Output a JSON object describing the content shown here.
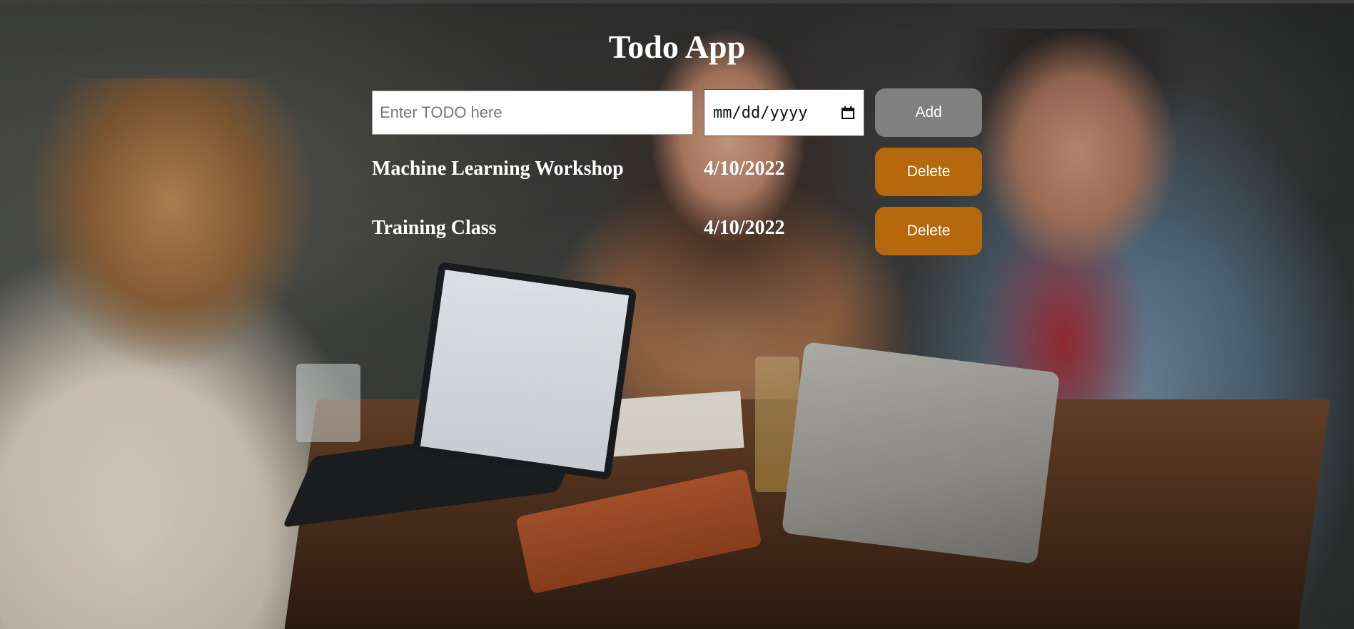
{
  "app": {
    "title": "Todo App"
  },
  "form": {
    "todo_placeholder": "Enter TODO here",
    "todo_value": "",
    "date_placeholder": "mm/dd/yyyy",
    "add_label": "Add"
  },
  "todos": [
    {
      "text": "Machine Learning Workshop",
      "date": "4/10/2022",
      "delete_label": "Delete"
    },
    {
      "text": "Training Class",
      "date": "4/10/2022",
      "delete_label": "Delete"
    }
  ],
  "colors": {
    "add_button": "#808080",
    "delete_button": "#b5690c",
    "title_text": "#ffffff"
  },
  "icons": {
    "date_picker": "calendar-icon"
  }
}
